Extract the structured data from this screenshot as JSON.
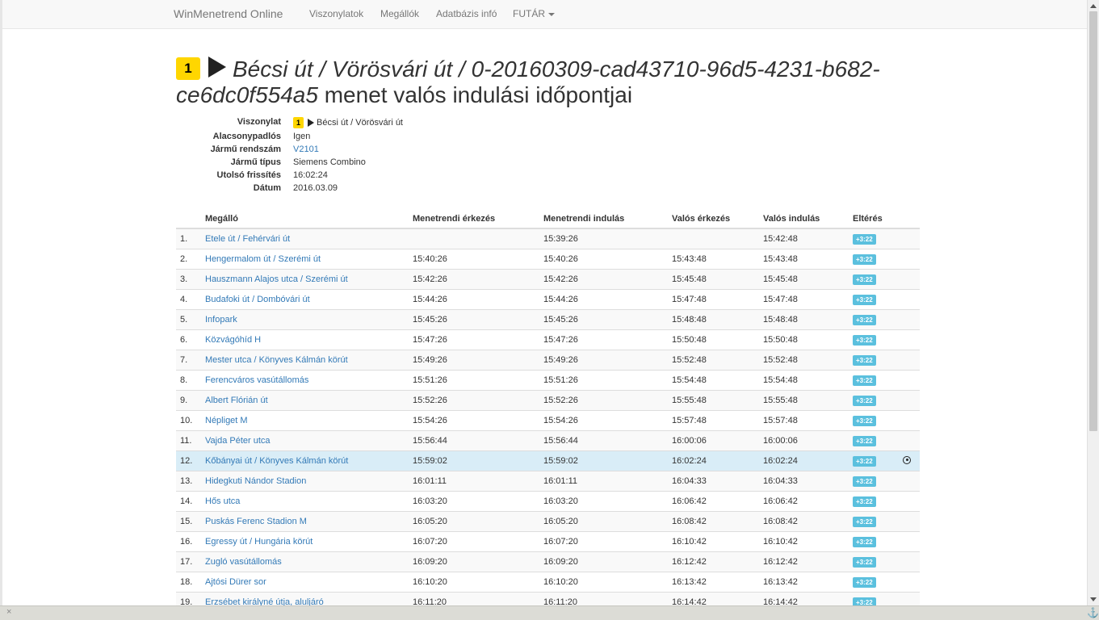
{
  "nav": {
    "brand": "WinMenetrend Online",
    "items": [
      "Viszonylatok",
      "Megállók",
      "Adatbázis infó",
      "FUTÁR"
    ]
  },
  "title": {
    "route_number": "1",
    "route_name": "Bécsi út / Vörösvári út / 0-20160309-cad43710-96d5-4231-b682-ce6dc0f554a5",
    "suffix": "menet valós indulási időpontjai"
  },
  "info": {
    "route_label": "Viszonylat",
    "route_number": "1",
    "route_value": "Bécsi út / Vörösvári út",
    "lowfloor_label": "Alacsonypadlós",
    "lowfloor_value": "Igen",
    "plate_label": "Jármű rendszám",
    "plate_value": "V2101",
    "type_label": "Jármű típus",
    "type_value": "Siemens Combino",
    "update_label": "Utolsó frissítés",
    "update_value": "16:02:24",
    "date_label": "Dátum",
    "date_value": "2016.03.09"
  },
  "table": {
    "headers": [
      "",
      "Megálló",
      "Menetrendi érkezés",
      "Menetrendi indulás",
      "Valós érkezés",
      "Valós indulás",
      "Eltérés",
      ""
    ],
    "rows": [
      {
        "idx": "1.",
        "stop": "Etele út / Fehérvári út",
        "sched_arr": "",
        "sched_dep": "15:39:26",
        "real_arr": "",
        "real_dep": "15:42:48",
        "diff": "+3:22"
      },
      {
        "idx": "2.",
        "stop": "Hengermalom út / Szerémi út",
        "sched_arr": "15:40:26",
        "sched_dep": "15:40:26",
        "real_arr": "15:43:48",
        "real_dep": "15:43:48",
        "diff": "+3:22"
      },
      {
        "idx": "3.",
        "stop": "Hauszmann Alajos utca / Szerémi út",
        "sched_arr": "15:42:26",
        "sched_dep": "15:42:26",
        "real_arr": "15:45:48",
        "real_dep": "15:45:48",
        "diff": "+3:22"
      },
      {
        "idx": "4.",
        "stop": "Budafoki út / Dombóvári út",
        "sched_arr": "15:44:26",
        "sched_dep": "15:44:26",
        "real_arr": "15:47:48",
        "real_dep": "15:47:48",
        "diff": "+3:22"
      },
      {
        "idx": "5.",
        "stop": "Infopark",
        "sched_arr": "15:45:26",
        "sched_dep": "15:45:26",
        "real_arr": "15:48:48",
        "real_dep": "15:48:48",
        "diff": "+3:22"
      },
      {
        "idx": "6.",
        "stop": "Közvágóhíd H",
        "sched_arr": "15:47:26",
        "sched_dep": "15:47:26",
        "real_arr": "15:50:48",
        "real_dep": "15:50:48",
        "diff": "+3:22"
      },
      {
        "idx": "7.",
        "stop": "Mester utca / Könyves Kálmán körút",
        "sched_arr": "15:49:26",
        "sched_dep": "15:49:26",
        "real_arr": "15:52:48",
        "real_dep": "15:52:48",
        "diff": "+3:22"
      },
      {
        "idx": "8.",
        "stop": "Ferencváros vasútállomás",
        "sched_arr": "15:51:26",
        "sched_dep": "15:51:26",
        "real_arr": "15:54:48",
        "real_dep": "15:54:48",
        "diff": "+3:22"
      },
      {
        "idx": "9.",
        "stop": "Albert Flórián út",
        "sched_arr": "15:52:26",
        "sched_dep": "15:52:26",
        "real_arr": "15:55:48",
        "real_dep": "15:55:48",
        "diff": "+3:22"
      },
      {
        "idx": "10.",
        "stop": "Népliget M",
        "sched_arr": "15:54:26",
        "sched_dep": "15:54:26",
        "real_arr": "15:57:48",
        "real_dep": "15:57:48",
        "diff": "+3:22"
      },
      {
        "idx": "11.",
        "stop": "Vajda Péter utca",
        "sched_arr": "15:56:44",
        "sched_dep": "15:56:44",
        "real_arr": "16:00:06",
        "real_dep": "16:00:06",
        "diff": "+3:22"
      },
      {
        "idx": "12.",
        "stop": "Kőbányai út / Könyves Kálmán körút",
        "sched_arr": "15:59:02",
        "sched_dep": "15:59:02",
        "real_arr": "16:02:24",
        "real_dep": "16:02:24",
        "diff": "+3:22",
        "current": true
      },
      {
        "idx": "13.",
        "stop": "Hidegkuti Nándor Stadion",
        "sched_arr": "16:01:11",
        "sched_dep": "16:01:11",
        "real_arr": "16:04:33",
        "real_dep": "16:04:33",
        "diff": "+3:22"
      },
      {
        "idx": "14.",
        "stop": "Hős utca",
        "sched_arr": "16:03:20",
        "sched_dep": "16:03:20",
        "real_arr": "16:06:42",
        "real_dep": "16:06:42",
        "diff": "+3:22"
      },
      {
        "idx": "15.",
        "stop": "Puskás Ferenc Stadion M",
        "sched_arr": "16:05:20",
        "sched_dep": "16:05:20",
        "real_arr": "16:08:42",
        "real_dep": "16:08:42",
        "diff": "+3:22"
      },
      {
        "idx": "16.",
        "stop": "Egressy út / Hungária körút",
        "sched_arr": "16:07:20",
        "sched_dep": "16:07:20",
        "real_arr": "16:10:42",
        "real_dep": "16:10:42",
        "diff": "+3:22"
      },
      {
        "idx": "17.",
        "stop": "Zugló vasútállomás",
        "sched_arr": "16:09:20",
        "sched_dep": "16:09:20",
        "real_arr": "16:12:42",
        "real_dep": "16:12:42",
        "diff": "+3:22"
      },
      {
        "idx": "18.",
        "stop": "Ajtósi Dürer sor",
        "sched_arr": "16:10:20",
        "sched_dep": "16:10:20",
        "real_arr": "16:13:42",
        "real_dep": "16:13:42",
        "diff": "+3:22"
      },
      {
        "idx": "19.",
        "stop": "Erzsébet királyné útja, aluljáró",
        "sched_arr": "16:11:20",
        "sched_dep": "16:11:20",
        "real_arr": "16:14:42",
        "real_dep": "16:14:42",
        "diff": "+3:22"
      }
    ]
  },
  "statusbar": {
    "close": "×",
    "anchor": "⚓"
  },
  "colors": {
    "accent_link": "#337ab7",
    "route_badge": "#ffd600",
    "diff_badge": "#5bc0de",
    "current_row": "#d9edf7"
  }
}
